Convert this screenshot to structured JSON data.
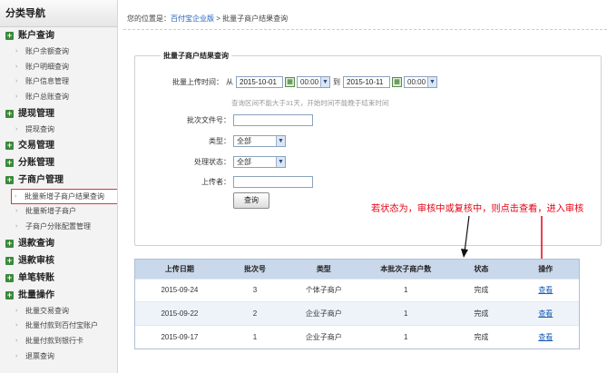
{
  "sidebar": {
    "title": "分类导航",
    "groups": [
      {
        "label": "账户查询",
        "items": [
          "账户余额查询",
          "账户明细查询",
          "账户信息管理",
          "账户总账查询"
        ]
      },
      {
        "label": "提现管理",
        "items": [
          "提现查询"
        ]
      },
      {
        "label": "交易管理",
        "items": []
      },
      {
        "label": "分账管理",
        "items": []
      },
      {
        "label": "子商户管理",
        "items": [
          "批量新增子商户结果查询",
          "批量新增子商户",
          "子商户分账配置管理"
        ]
      },
      {
        "label": "退款查询",
        "items": []
      },
      {
        "label": "退款审核",
        "items": []
      },
      {
        "label": "单笔转账",
        "items": []
      },
      {
        "label": "批量操作",
        "items": [
          "批量交易查询",
          "批量付款到百付宝账户",
          "批量付款到银行卡",
          "退票查询"
        ]
      }
    ],
    "active_item": "批量新增子商户结果查询"
  },
  "breadcrumb": {
    "prefix": "您的位置是：",
    "home": "百付宝企业版",
    "separator": ">",
    "current": "批量子商户结果查询"
  },
  "query": {
    "legend": "批量子商户结果查询",
    "upload_time_label": "批量上传时间：",
    "from": "从",
    "start_date": "2015-10-01",
    "start_time": "00:00",
    "to": "到",
    "end_date": "2015-10-11",
    "end_time": "00:00",
    "hint": "查询区间不能大于31天，开始时间不能晚于结束时间",
    "batch_file_label": "批次文件号：",
    "batch_file_value": "",
    "type_label": "类型：",
    "type_value": "全部",
    "status_label": "处理状态：",
    "status_value": "全部",
    "uploader_label": "上传者：",
    "uploader_value": "",
    "submit": "查询"
  },
  "annotation": "若状态为，审核中或复核中，则点击查看，进入审核",
  "table": {
    "headers": [
      "上传日期",
      "批次号",
      "类型",
      "本批次子商户数",
      "状态",
      "操作"
    ],
    "rows": [
      [
        "2015-09-24",
        "3",
        "个体子商户",
        "1",
        "完成",
        "查看"
      ],
      [
        "2015-09-22",
        "2",
        "企业子商户",
        "1",
        "完成",
        "查看"
      ],
      [
        "2015-09-17",
        "1",
        "企业子商户",
        "1",
        "完成",
        "查看"
      ]
    ]
  },
  "colors": {
    "accent_link": "#1a5fb4",
    "annotation_red": "#e60012",
    "table_header": "#c9d8ea"
  }
}
